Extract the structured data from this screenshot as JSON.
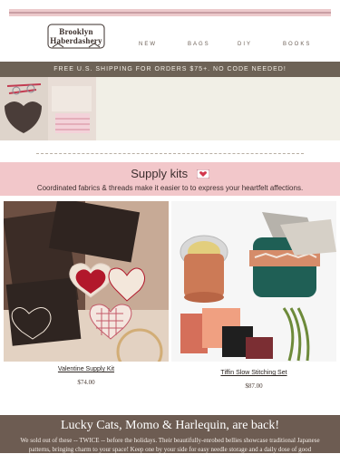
{
  "header": {
    "logo_text": "Brooklyn Haberdashery",
    "nav": [
      "NEW",
      "BAGS",
      "DIY",
      "BOOKS"
    ]
  },
  "shipping_banner": "FREE U.S. SHIPPING FOR ORDERS $75+. NO CODE NEEDED!",
  "supply": {
    "title": "Supply kits",
    "subtitle": "Coordinated fabrics & threads make it easier to to express your heartfelt affections."
  },
  "products": [
    {
      "name": "Valentine Supply Kit",
      "price": "$74.00"
    },
    {
      "name": "Tiffin Slow Stitching Set",
      "price": "$87.00"
    }
  ],
  "announcement": {
    "title": "Lucky Cats, Momo & Harlequin, are back!",
    "body_1": "We sold out of these -- TWICE -- before the holidays. Their beautifully-enrobed bellies showcase traditional Japanese",
    "body_2": "patterns, bringing charm to your space! Keep one by your side for easy needle storage and a daily dose of good"
  },
  "colors": {
    "pink_band": "#f2c7ca",
    "shipping_bg": "#6d6256",
    "announcement_bg": "#6d5c52"
  }
}
